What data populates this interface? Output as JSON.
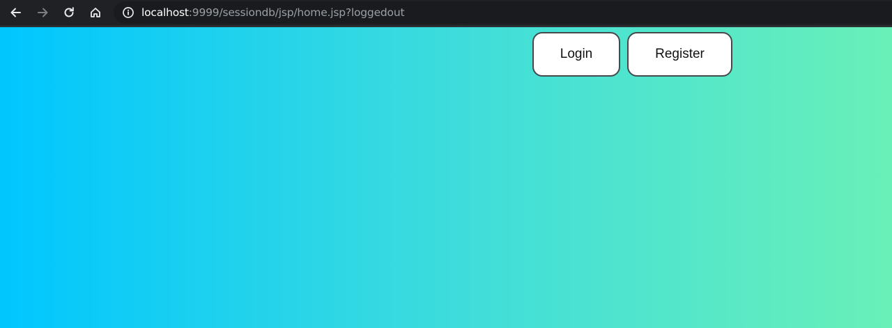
{
  "browser": {
    "url_host": "localhost",
    "url_path": ":9999/sessiondb/jsp/home.jsp?loggedout",
    "icons": {
      "back": "arrow-left-icon",
      "forward": "arrow-right-icon",
      "reload": "reload-icon",
      "home": "home-icon",
      "site_info": "info-icon"
    }
  },
  "page": {
    "login_label": "Login",
    "register_label": "Register",
    "gradient": {
      "start": "#00c6ff",
      "end": "#69f0b8"
    }
  }
}
